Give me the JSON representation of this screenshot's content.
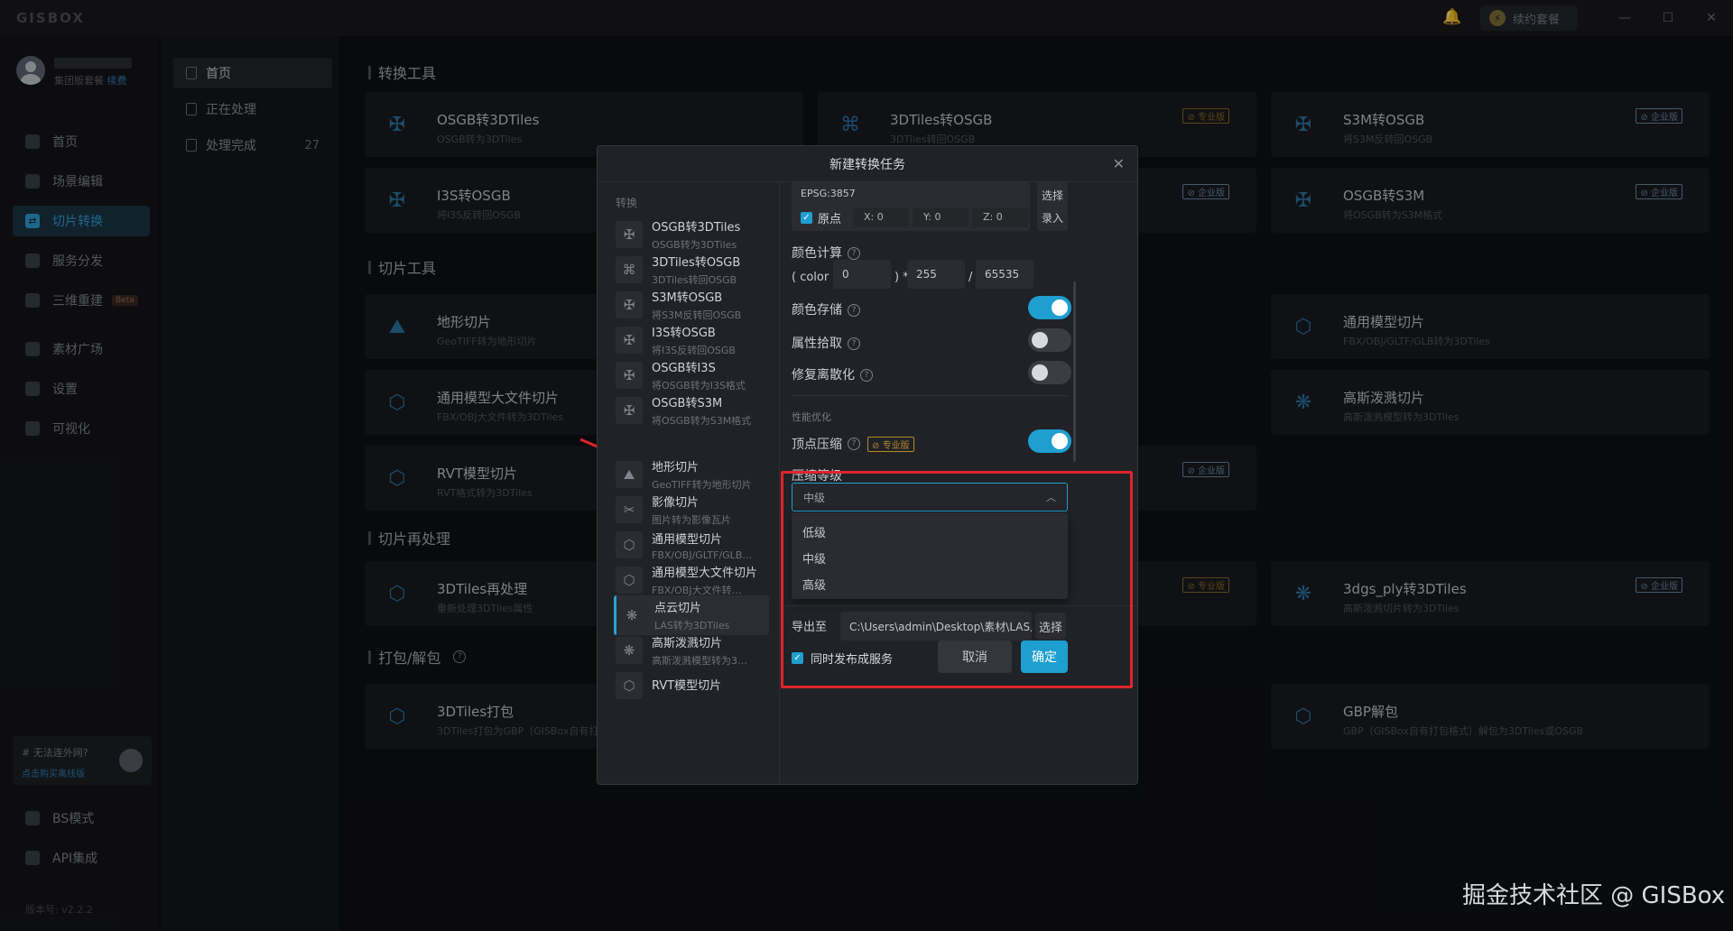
{
  "app": {
    "logo": "GISBOX"
  },
  "titlebar": {
    "renew_label": "续约套餐"
  },
  "user": {
    "plan": "集团版套餐",
    "renew_link": "续费"
  },
  "sidebar": {
    "items": [
      {
        "label": "首页"
      },
      {
        "label": "场景编辑"
      },
      {
        "label": "切片转换"
      },
      {
        "label": "服务分发"
      },
      {
        "label": "三维重建",
        "badge": "Beta"
      },
      {
        "label": "素材广场"
      },
      {
        "label": "设置"
      },
      {
        "label": "可视化"
      }
    ],
    "promo_title": "# 无法连外网?",
    "promo_link": "点击购买离线版",
    "bottom_items": [
      {
        "label": "BS模式"
      },
      {
        "label": "API集成"
      }
    ],
    "version": "版本号: v2.2.2"
  },
  "subnav": {
    "items": [
      {
        "label": "首页",
        "count": ""
      },
      {
        "label": "正在处理",
        "count": ""
      },
      {
        "label": "处理完成",
        "count": "27"
      }
    ]
  },
  "sections": {
    "convert": "转换工具",
    "slice": "切片工具",
    "reprocess": "切片再处理",
    "pack": "打包/解包"
  },
  "cards": [
    {
      "title": "OSGB转3DTiles",
      "sub": "OSGB转为3DTiles",
      "badge": ""
    },
    {
      "title": "3DTiles转OSGB",
      "sub": "3DTiles转回OSGB",
      "badge": "专业版"
    },
    {
      "title": "S3M转OSGB",
      "sub": "将S3M反转回OSGB",
      "badge": "企业版"
    },
    {
      "title": "I3S转OSGB",
      "sub": "将I3S反转回OSGB",
      "badge": ""
    },
    {
      "title": "",
      "sub": "",
      "badge": "企业版"
    },
    {
      "title": "OSGB转S3M",
      "sub": "将OSGB转为S3M格式",
      "badge": "企业版"
    },
    {
      "title": "地形切片",
      "sub": "GeoTIFF转为地形切片",
      "badge": ""
    },
    {
      "title": "通用模型切片",
      "sub": "FBX/OBJ/GLTF/GLB转为3DTiles",
      "badge": ""
    },
    {
      "title": "通用模型大文件切片",
      "sub": "FBX/OBJ大文件转为3DTiles",
      "badge": ""
    },
    {
      "title": "高斯泼溅切片",
      "sub": "高斯泼溅模型转为3DTiles",
      "badge": ""
    },
    {
      "title": "RVT模型切片",
      "sub": "RVT格式转为3DTiles",
      "badge": ""
    },
    {
      "title": "",
      "sub": "",
      "badge": "企业版"
    },
    {
      "title": "3DTiles再处理",
      "sub": "重新处理3DTiles属性",
      "badge": ""
    },
    {
      "title": "",
      "sub": "",
      "badge": "专业版"
    },
    {
      "title": "3dgs_ply转3DTiles",
      "sub": "高斯泼溅切片转为3DTiles",
      "badge": "企业版"
    },
    {
      "title": "3DTiles打包",
      "sub": "3DTiles打包为GBP（GISBox自有打",
      "badge": ""
    },
    {
      "title": "GBP解包",
      "sub": "GBP（GISBox自有打包格式）解包为3DTiles或OSGB",
      "badge": ""
    }
  ],
  "modal": {
    "title": "新建转换任务",
    "groups": {
      "convert": "转换",
      "slice": "切片"
    },
    "items": [
      {
        "title": "OSGB转3DTiles",
        "sub": "OSGB转为3DTiles"
      },
      {
        "title": "3DTiles转OSGB",
        "sub": "3DTiles转回OSGB"
      },
      {
        "title": "S3M转OSGB",
        "sub": "将S3M反转回OSGB"
      },
      {
        "title": "I3S转OSGB",
        "sub": "将I3S反转回OSGB"
      },
      {
        "title": "OSGB转I3S",
        "sub": "将OSGB转为I3S格式"
      },
      {
        "title": "OSGB转S3M",
        "sub": "将OSGB转为S3M格式"
      },
      {
        "title": "地形切片",
        "sub": "GeoTIFF转为地形切片"
      },
      {
        "title": "影像切片",
        "sub": "图片转为影像瓦片"
      },
      {
        "title": "通用模型切片",
        "sub": "FBX/OBJ/GLTF/GLB…"
      },
      {
        "title": "通用模型大文件切片",
        "sub": "FBX/OBJ大文件转…"
      },
      {
        "title": "点云切片",
        "sub": "LAS转为3DTiles"
      },
      {
        "title": "高斯泼溅切片",
        "sub": "高斯泼溅模型转为3…"
      },
      {
        "title": "RVT模型切片",
        "sub": ""
      }
    ],
    "epsg": "EPSG:3857",
    "origin_label": "原点",
    "x": "X: 0",
    "y": "Y: 0",
    "z": "Z: 0",
    "select_label": "选择",
    "input_label": "录入",
    "color_calc_label": "颜色计算",
    "color_prefix": "( color +",
    "color_add": "0",
    "color_mid": ") *",
    "color_mul": "255",
    "color_div_sign": "/",
    "color_div": "65535",
    "color_store_label": "颜色存储",
    "color_store_on": true,
    "attr_pick_label": "属性拾取",
    "attr_pick_on": false,
    "repair_label": "修复离散化",
    "repair_on": false,
    "perf_label": "性能优化",
    "vertex_label": "顶点压缩",
    "vertex_badge": "专业版",
    "vertex_on": true,
    "level_label": "压缩等级",
    "level_value": "中级",
    "level_options": [
      "低级",
      "中级",
      "高级"
    ],
    "export_label": "导出至",
    "export_path": "C:\\Users\\admin\\Desktop\\素材\\LAS点云…",
    "export_select": "选择",
    "publish_label": "同时发布成服务",
    "cancel_label": "取消",
    "confirm_label": "确定"
  },
  "watermark": "掘金技术社区 @ GISBox",
  "colors": {
    "accent": "#1e9fd0",
    "highlight": "#e0242a",
    "arrow": "#e0242a"
  }
}
